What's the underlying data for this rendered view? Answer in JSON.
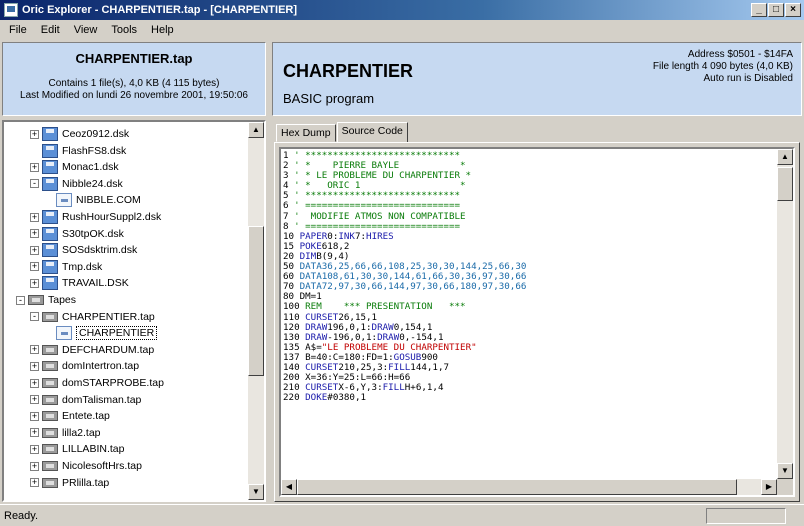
{
  "window": {
    "title": "Oric Explorer - CHARPENTIER.tap - [CHARPENTIER]",
    "min": "_",
    "max": "□",
    "close": "×"
  },
  "menu": [
    "File",
    "Edit",
    "View",
    "Tools",
    "Help"
  ],
  "left_info": {
    "filename": "CHARPENTIER.tap",
    "contains": "Contains 1 file(s), 4,0 KB (4 115 bytes)",
    "modified": "Last Modified on lundi 26 novembre 2001, 19:50:06"
  },
  "tree": {
    "items": [
      {
        "label": "Ceoz0912.dsk",
        "icon": "disk-icon"
      },
      {
        "label": "FlashFS8.dsk",
        "icon": "disk-icon"
      },
      {
        "label": "Monac1.dsk",
        "icon": "disk-icon"
      },
      {
        "label": "Nibble24.dsk",
        "icon": "disk-icon"
      },
      {
        "label": "NIBBLE.COM",
        "icon": "file-icon"
      },
      {
        "label": "RushHourSuppl2.dsk",
        "icon": "disk-icon"
      },
      {
        "label": "S30tpOK.dsk",
        "icon": "disk-icon"
      },
      {
        "label": "SOSdsktrim.dsk",
        "icon": "disk-icon"
      },
      {
        "label": "Tmp.dsk",
        "icon": "disk-icon"
      },
      {
        "label": "TRAVAIL.DSK",
        "icon": "disk-icon"
      },
      {
        "label": "Tapes",
        "icon": "tape-icon"
      },
      {
        "label": "CHARPENTIER.tap",
        "icon": "tape-icon"
      },
      {
        "label": "CHARPENTIER",
        "icon": "file-icon"
      },
      {
        "label": "DEFCHARDUM.tap",
        "icon": "tape-icon"
      },
      {
        "label": "domIntertron.tap",
        "icon": "tape-icon"
      },
      {
        "label": "domSTARPROBE.tap",
        "icon": "tape-icon"
      },
      {
        "label": "domTalisman.tap",
        "icon": "tape-icon"
      },
      {
        "label": "Entete.tap",
        "icon": "tape-icon"
      },
      {
        "label": "lilla2.tap",
        "icon": "tape-icon"
      },
      {
        "label": "LILLABIN.tap",
        "icon": "tape-icon"
      },
      {
        "label": "NicolesoftHrs.tap",
        "icon": "tape-icon"
      },
      {
        "label": "PRlilla.tap",
        "icon": "tape-icon"
      }
    ],
    "selected": "CHARPENTIER"
  },
  "program": {
    "name": "CHARPENTIER",
    "type": "BASIC program",
    "address": "Address $0501 - $14FA",
    "length": "File length 4 090 bytes (4,0 KB)",
    "autorun": "Auto run is Disabled"
  },
  "tabs": [
    "Hex Dump",
    "Source Code"
  ],
  "active_tab": "Source Code",
  "source": [
    [
      {
        "t": "1 ",
        "c": "num"
      },
      {
        "t": "' ****************************",
        "c": "rem"
      }
    ],
    [
      {
        "t": "2 ",
        "c": "num"
      },
      {
        "t": "' *    PIERRE BAYLE           *",
        "c": "rem"
      }
    ],
    [
      {
        "t": "3 ",
        "c": "num"
      },
      {
        "t": "' * LE PROBLEME DU CHARPENTIER *",
        "c": "rem"
      }
    ],
    [
      {
        "t": "4 ",
        "c": "num"
      },
      {
        "t": "' *   ORIC 1                  *",
        "c": "rem"
      }
    ],
    [
      {
        "t": "5 ",
        "c": "num"
      },
      {
        "t": "' ****************************",
        "c": "rem"
      }
    ],
    [
      {
        "t": "6 ",
        "c": "num"
      },
      {
        "t": "' ============================",
        "c": "rem"
      }
    ],
    [
      {
        "t": "7 ",
        "c": "num"
      },
      {
        "t": "'  MODIFIE ATMOS NON COMPATIBLE",
        "c": "rem"
      }
    ],
    [
      {
        "t": "8 ",
        "c": "num"
      },
      {
        "t": "' ============================",
        "c": "rem"
      }
    ],
    [
      {
        "t": "10 ",
        "c": "num"
      },
      {
        "t": "PAPER",
        "c": "kw"
      },
      {
        "t": "0:",
        "c": "num"
      },
      {
        "t": "INK",
        "c": "kw"
      },
      {
        "t": "7:",
        "c": "num"
      },
      {
        "t": "HIRES",
        "c": "kw"
      }
    ],
    [
      {
        "t": "15 ",
        "c": "num"
      },
      {
        "t": "POKE",
        "c": "kw"
      },
      {
        "t": "618,2",
        "c": "num"
      }
    ],
    [
      {
        "t": "20 ",
        "c": "num"
      },
      {
        "t": "DIM",
        "c": "kw"
      },
      {
        "t": "B(9,4)",
        "c": "num"
      }
    ],
    [
      {
        "t": "50 ",
        "c": "num"
      },
      {
        "t": "DATA36,25,66,66,108,25,30,30,144,25,66,30",
        "c": "data"
      }
    ],
    [
      {
        "t": "60 ",
        "c": "num"
      },
      {
        "t": "DATA108,61,30,30,144,61,66,30,36,97,30,66",
        "c": "data"
      }
    ],
    [
      {
        "t": "70 ",
        "c": "num"
      },
      {
        "t": "DATA72,97,30,66,144,97,30,66,180,97,30,66",
        "c": "data"
      }
    ],
    [
      {
        "t": "80 ",
        "c": "num"
      },
      {
        "t": "DM=1",
        "c": "num"
      }
    ],
    [
      {
        "t": "100 ",
        "c": "num"
      },
      {
        "t": "REM    *** PRESENTATION   ***",
        "c": "rem"
      }
    ],
    [
      {
        "t": "110 ",
        "c": "num"
      },
      {
        "t": "CURSET",
        "c": "kw"
      },
      {
        "t": "26,15,1",
        "c": "num"
      }
    ],
    [
      {
        "t": "120 ",
        "c": "num"
      },
      {
        "t": "DRAW",
        "c": "kw"
      },
      {
        "t": "196,0,1:",
        "c": "num"
      },
      {
        "t": "DRAW",
        "c": "kw"
      },
      {
        "t": "0,154,1",
        "c": "num"
      }
    ],
    [
      {
        "t": "130 ",
        "c": "num"
      },
      {
        "t": "DRAW",
        "c": "kw"
      },
      {
        "t": "-196,0,1:",
        "c": "num"
      },
      {
        "t": "DRAW",
        "c": "kw"
      },
      {
        "t": "0,-154,1",
        "c": "num"
      }
    ],
    [
      {
        "t": "135 ",
        "c": "num"
      },
      {
        "t": "A$=",
        "c": "num"
      },
      {
        "t": "\"LE PROBLEME DU CHARPENTIER\"",
        "c": "str"
      }
    ],
    [
      {
        "t": "137 ",
        "c": "num"
      },
      {
        "t": "B=40:C=180:FD=1:",
        "c": "num"
      },
      {
        "t": "GOSUB",
        "c": "kw"
      },
      {
        "t": "900",
        "c": "num"
      }
    ],
    [
      {
        "t": "140 ",
        "c": "num"
      },
      {
        "t": "CURSET",
        "c": "kw"
      },
      {
        "t": "210,25,3:",
        "c": "num"
      },
      {
        "t": "FILL",
        "c": "kw"
      },
      {
        "t": "144,1,7",
        "c": "num"
      }
    ],
    [
      {
        "t": "200 ",
        "c": "num"
      },
      {
        "t": "X=36:Y=25:L=66:H=66",
        "c": "num"
      }
    ],
    [
      {
        "t": "210 ",
        "c": "num"
      },
      {
        "t": "CURSET",
        "c": "kw"
      },
      {
        "t": "X-6,Y,3:",
        "c": "num"
      },
      {
        "t": "FILL",
        "c": "kw"
      },
      {
        "t": "H+6,1,4",
        "c": "num"
      }
    ],
    [
      {
        "t": "220 ",
        "c": "num"
      },
      {
        "t": "DOKE",
        "c": "kw"
      },
      {
        "t": "#0380,1",
        "c": "num"
      }
    ]
  ],
  "status": {
    "text": "Ready."
  }
}
